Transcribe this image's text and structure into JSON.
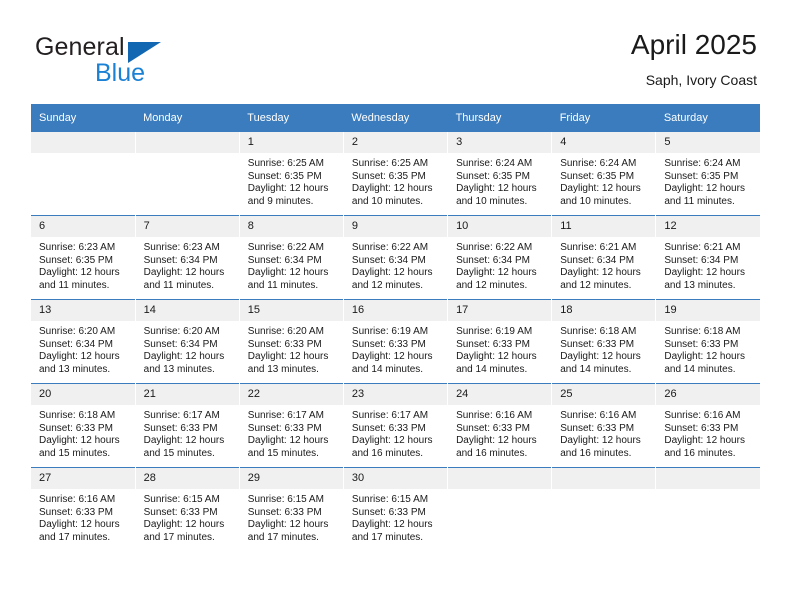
{
  "brand": {
    "name_top": "General",
    "name_bottom": "Blue",
    "flag_color": "#1267b2",
    "blue_color": "#1b81d4"
  },
  "header": {
    "title": "April 2025",
    "subtitle": "Saph, Ivory Coast"
  },
  "theme": {
    "header_row_bg": "#3a7cbe",
    "daynum_bg": "#f0f0f0",
    "grid_line": "#3a7cbe"
  },
  "weekday_headers": [
    "Sunday",
    "Monday",
    "Tuesday",
    "Wednesday",
    "Thursday",
    "Friday",
    "Saturday"
  ],
  "weeks": [
    [
      {
        "day": "",
        "blank": true,
        "sunrise": "",
        "sunset": "",
        "daylight_1": "",
        "daylight_2": ""
      },
      {
        "day": "",
        "blank": true,
        "sunrise": "",
        "sunset": "",
        "daylight_1": "",
        "daylight_2": ""
      },
      {
        "day": "1",
        "sunrise": "Sunrise: 6:25 AM",
        "sunset": "Sunset: 6:35 PM",
        "daylight_1": "Daylight: 12 hours",
        "daylight_2": "and 9 minutes."
      },
      {
        "day": "2",
        "sunrise": "Sunrise: 6:25 AM",
        "sunset": "Sunset: 6:35 PM",
        "daylight_1": "Daylight: 12 hours",
        "daylight_2": "and 10 minutes."
      },
      {
        "day": "3",
        "sunrise": "Sunrise: 6:24 AM",
        "sunset": "Sunset: 6:35 PM",
        "daylight_1": "Daylight: 12 hours",
        "daylight_2": "and 10 minutes."
      },
      {
        "day": "4",
        "sunrise": "Sunrise: 6:24 AM",
        "sunset": "Sunset: 6:35 PM",
        "daylight_1": "Daylight: 12 hours",
        "daylight_2": "and 10 minutes."
      },
      {
        "day": "5",
        "sunrise": "Sunrise: 6:24 AM",
        "sunset": "Sunset: 6:35 PM",
        "daylight_1": "Daylight: 12 hours",
        "daylight_2": "and 11 minutes."
      }
    ],
    [
      {
        "day": "6",
        "sunrise": "Sunrise: 6:23 AM",
        "sunset": "Sunset: 6:35 PM",
        "daylight_1": "Daylight: 12 hours",
        "daylight_2": "and 11 minutes."
      },
      {
        "day": "7",
        "sunrise": "Sunrise: 6:23 AM",
        "sunset": "Sunset: 6:34 PM",
        "daylight_1": "Daylight: 12 hours",
        "daylight_2": "and 11 minutes."
      },
      {
        "day": "8",
        "sunrise": "Sunrise: 6:22 AM",
        "sunset": "Sunset: 6:34 PM",
        "daylight_1": "Daylight: 12 hours",
        "daylight_2": "and 11 minutes."
      },
      {
        "day": "9",
        "sunrise": "Sunrise: 6:22 AM",
        "sunset": "Sunset: 6:34 PM",
        "daylight_1": "Daylight: 12 hours",
        "daylight_2": "and 12 minutes."
      },
      {
        "day": "10",
        "sunrise": "Sunrise: 6:22 AM",
        "sunset": "Sunset: 6:34 PM",
        "daylight_1": "Daylight: 12 hours",
        "daylight_2": "and 12 minutes."
      },
      {
        "day": "11",
        "sunrise": "Sunrise: 6:21 AM",
        "sunset": "Sunset: 6:34 PM",
        "daylight_1": "Daylight: 12 hours",
        "daylight_2": "and 12 minutes."
      },
      {
        "day": "12",
        "sunrise": "Sunrise: 6:21 AM",
        "sunset": "Sunset: 6:34 PM",
        "daylight_1": "Daylight: 12 hours",
        "daylight_2": "and 13 minutes."
      }
    ],
    [
      {
        "day": "13",
        "sunrise": "Sunrise: 6:20 AM",
        "sunset": "Sunset: 6:34 PM",
        "daylight_1": "Daylight: 12 hours",
        "daylight_2": "and 13 minutes."
      },
      {
        "day": "14",
        "sunrise": "Sunrise: 6:20 AM",
        "sunset": "Sunset: 6:34 PM",
        "daylight_1": "Daylight: 12 hours",
        "daylight_2": "and 13 minutes."
      },
      {
        "day": "15",
        "sunrise": "Sunrise: 6:20 AM",
        "sunset": "Sunset: 6:33 PM",
        "daylight_1": "Daylight: 12 hours",
        "daylight_2": "and 13 minutes."
      },
      {
        "day": "16",
        "sunrise": "Sunrise: 6:19 AM",
        "sunset": "Sunset: 6:33 PM",
        "daylight_1": "Daylight: 12 hours",
        "daylight_2": "and 14 minutes."
      },
      {
        "day": "17",
        "sunrise": "Sunrise: 6:19 AM",
        "sunset": "Sunset: 6:33 PM",
        "daylight_1": "Daylight: 12 hours",
        "daylight_2": "and 14 minutes."
      },
      {
        "day": "18",
        "sunrise": "Sunrise: 6:18 AM",
        "sunset": "Sunset: 6:33 PM",
        "daylight_1": "Daylight: 12 hours",
        "daylight_2": "and 14 minutes."
      },
      {
        "day": "19",
        "sunrise": "Sunrise: 6:18 AM",
        "sunset": "Sunset: 6:33 PM",
        "daylight_1": "Daylight: 12 hours",
        "daylight_2": "and 14 minutes."
      }
    ],
    [
      {
        "day": "20",
        "sunrise": "Sunrise: 6:18 AM",
        "sunset": "Sunset: 6:33 PM",
        "daylight_1": "Daylight: 12 hours",
        "daylight_2": "and 15 minutes."
      },
      {
        "day": "21",
        "sunrise": "Sunrise: 6:17 AM",
        "sunset": "Sunset: 6:33 PM",
        "daylight_1": "Daylight: 12 hours",
        "daylight_2": "and 15 minutes."
      },
      {
        "day": "22",
        "sunrise": "Sunrise: 6:17 AM",
        "sunset": "Sunset: 6:33 PM",
        "daylight_1": "Daylight: 12 hours",
        "daylight_2": "and 15 minutes."
      },
      {
        "day": "23",
        "sunrise": "Sunrise: 6:17 AM",
        "sunset": "Sunset: 6:33 PM",
        "daylight_1": "Daylight: 12 hours",
        "daylight_2": "and 16 minutes."
      },
      {
        "day": "24",
        "sunrise": "Sunrise: 6:16 AM",
        "sunset": "Sunset: 6:33 PM",
        "daylight_1": "Daylight: 12 hours",
        "daylight_2": "and 16 minutes."
      },
      {
        "day": "25",
        "sunrise": "Sunrise: 6:16 AM",
        "sunset": "Sunset: 6:33 PM",
        "daylight_1": "Daylight: 12 hours",
        "daylight_2": "and 16 minutes."
      },
      {
        "day": "26",
        "sunrise": "Sunrise: 6:16 AM",
        "sunset": "Sunset: 6:33 PM",
        "daylight_1": "Daylight: 12 hours",
        "daylight_2": "and 16 minutes."
      }
    ],
    [
      {
        "day": "27",
        "sunrise": "Sunrise: 6:16 AM",
        "sunset": "Sunset: 6:33 PM",
        "daylight_1": "Daylight: 12 hours",
        "daylight_2": "and 17 minutes."
      },
      {
        "day": "28",
        "sunrise": "Sunrise: 6:15 AM",
        "sunset": "Sunset: 6:33 PM",
        "daylight_1": "Daylight: 12 hours",
        "daylight_2": "and 17 minutes."
      },
      {
        "day": "29",
        "sunrise": "Sunrise: 6:15 AM",
        "sunset": "Sunset: 6:33 PM",
        "daylight_1": "Daylight: 12 hours",
        "daylight_2": "and 17 minutes."
      },
      {
        "day": "30",
        "sunrise": "Sunrise: 6:15 AM",
        "sunset": "Sunset: 6:33 PM",
        "daylight_1": "Daylight: 12 hours",
        "daylight_2": "and 17 minutes."
      },
      {
        "day": "",
        "blank": true,
        "sunrise": "",
        "sunset": "",
        "daylight_1": "",
        "daylight_2": ""
      },
      {
        "day": "",
        "blank": true,
        "sunrise": "",
        "sunset": "",
        "daylight_1": "",
        "daylight_2": ""
      },
      {
        "day": "",
        "blank": true,
        "sunrise": "",
        "sunset": "",
        "daylight_1": "",
        "daylight_2": ""
      }
    ]
  ]
}
